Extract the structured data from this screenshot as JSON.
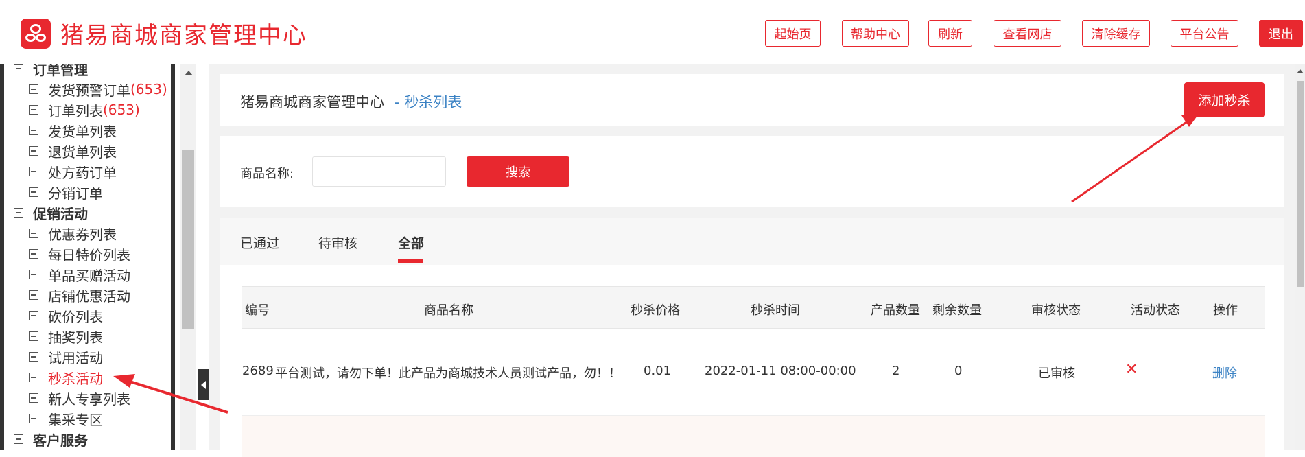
{
  "app": {
    "logo_text": "猪易商城商家管理中心"
  },
  "header": {
    "buttons": [
      {
        "label": "起始页"
      },
      {
        "label": "帮助中心"
      },
      {
        "label": "刷新"
      },
      {
        "label": "查看网店"
      },
      {
        "label": "清除缓存"
      },
      {
        "label": "平台公告"
      },
      {
        "label": "退出"
      }
    ]
  },
  "sidebar": {
    "groups": [
      {
        "label": "订单管理"
      },
      {
        "label": "促销活动"
      },
      {
        "label": "客户服务"
      }
    ],
    "items": [
      {
        "label": "发货预警订单",
        "count": "(653)"
      },
      {
        "label": "订单列表",
        "count": "(653)"
      },
      {
        "label": "发货单列表"
      },
      {
        "label": "退货单列表"
      },
      {
        "label": "处方药订单"
      },
      {
        "label": "分销订单"
      },
      {
        "label": "优惠券列表"
      },
      {
        "label": "每日特价列表"
      },
      {
        "label": "单品买赠活动"
      },
      {
        "label": "店铺优惠活动"
      },
      {
        "label": "砍价列表"
      },
      {
        "label": "抽奖列表"
      },
      {
        "label": "试用活动"
      },
      {
        "label": "秒杀活动"
      },
      {
        "label": "新人专享列表"
      },
      {
        "label": "集采专区"
      }
    ]
  },
  "page": {
    "breadcrumb_root": "猪易商城商家管理中心",
    "breadcrumb_current": "- 秒杀列表",
    "add_button": "添加秒杀"
  },
  "search": {
    "label": "商品名称:",
    "value": "",
    "button": "搜索"
  },
  "tabs": [
    {
      "label": "已通过"
    },
    {
      "label": "待审核"
    },
    {
      "label": "全部"
    }
  ],
  "table": {
    "columns": [
      "编号",
      "商品名称",
      "秒杀价格",
      "秒杀时间",
      "产品数量",
      "剩余数量",
      "审核状态",
      "活动状态",
      "操作"
    ],
    "rows": [
      {
        "id": "2689",
        "name": "平台测试，请勿下单！此产品为商城技术人员测试产品，勿！！",
        "price": "0.01",
        "time": "2022-01-11 08:00-00:00",
        "quantity": "2",
        "remaining": "0",
        "review_status": "已审核",
        "activity_status_icon": "x-icon",
        "action": "删除"
      }
    ]
  },
  "colors": {
    "accent": "#e8282f",
    "link": "#3b82c4"
  }
}
